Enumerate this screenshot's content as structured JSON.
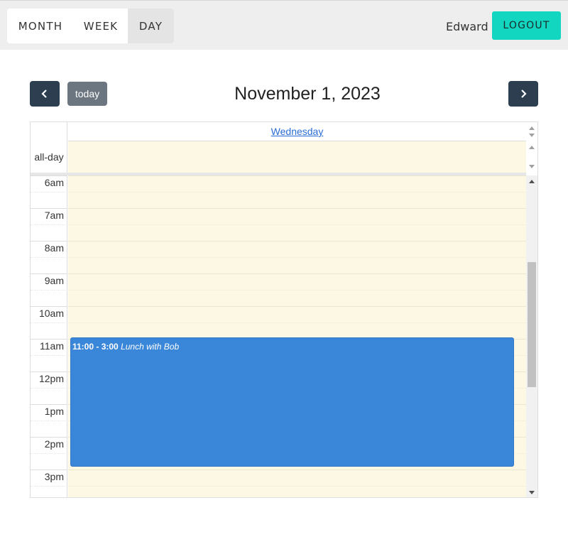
{
  "header": {
    "views": [
      "MONTH",
      "WEEK",
      "DAY"
    ],
    "active_view": "DAY",
    "user_name": "Edward",
    "logout_label": "LOGOUT"
  },
  "toolbar": {
    "prev_icon": "chevron-left-icon",
    "next_icon": "chevron-right-icon",
    "today_label": "today",
    "title": "November 1, 2023"
  },
  "calendar": {
    "day_header": "Wednesday",
    "allday_label": "all-day",
    "hour_labels": [
      "6am",
      "7am",
      "8am",
      "9am",
      "10am",
      "11am",
      "12pm",
      "1pm",
      "2pm",
      "3pm"
    ],
    "event": {
      "time": "11:00 - 3:00",
      "title": "Lunch with Bob",
      "color": "#3a87d9"
    },
    "slot_color": "#fcf8e3"
  },
  "colors": {
    "logout_bg": "#12d6c0",
    "nav_bg": "#2c3e50",
    "today_bg": "#6c7680"
  }
}
